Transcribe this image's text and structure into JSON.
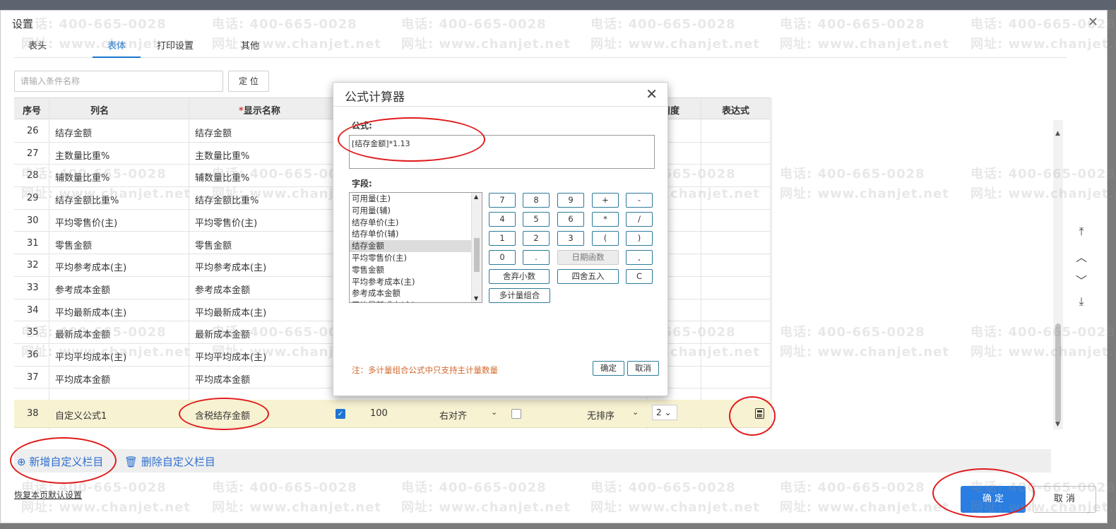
{
  "dialog": {
    "title": "设置",
    "close": "✕"
  },
  "tabs": [
    "表头",
    "表体",
    "打印设置",
    "其他"
  ],
  "search": {
    "placeholder": "请输入条件名称",
    "locate_label": "定 位"
  },
  "table": {
    "headers": {
      "no": "序号",
      "col_name": "列名",
      "required_mark": "*",
      "display_name": "显示名称",
      "precision": "精度",
      "expression": "表达式"
    },
    "rows": [
      {
        "no": "26",
        "name": "结存金额",
        "display": "结存金额"
      },
      {
        "no": "27",
        "name": "主数量比重%",
        "display": "主数量比重%"
      },
      {
        "no": "28",
        "name": "辅数量比重%",
        "display": "辅数量比重%"
      },
      {
        "no": "29",
        "name": "结存金额比重%",
        "display": "结存金额比重%"
      },
      {
        "no": "30",
        "name": "平均零售价(主)",
        "display": "平均零售价(主)"
      },
      {
        "no": "31",
        "name": "零售金额",
        "display": "零售金额"
      },
      {
        "no": "32",
        "name": "平均参考成本(主)",
        "display": "平均参考成本(主)"
      },
      {
        "no": "33",
        "name": "参考成本金额",
        "display": "参考成本金额"
      },
      {
        "no": "34",
        "name": "平均最新成本(主)",
        "display": "平均最新成本(主)"
      },
      {
        "no": "35",
        "name": "最新成本金额",
        "display": "最新成本金额"
      },
      {
        "no": "36",
        "name": "平均平均成本(主)",
        "display": "平均平均成本(主)"
      },
      {
        "no": "37",
        "name": "平均成本金额",
        "display": "平均成本金额"
      }
    ],
    "selected_row": {
      "no": "38",
      "name": "自定义公式1",
      "display": "含税结存金额",
      "width": "100",
      "align": "右对齐",
      "sort": "无排序",
      "precision": "2"
    }
  },
  "footer": {
    "add_custom": "新增自定义栏目",
    "delete_custom": "删除自定义栏目",
    "restore": "恢复本页默认设置",
    "ok": "确 定",
    "cancel": "取 消"
  },
  "formula_dialog": {
    "title": "公式计算器",
    "close": "✕",
    "formula_label": "公式:",
    "formula_value": "[结存金额]*1.13",
    "fields_label": "字段:",
    "fields": [
      "可用量(主)",
      "可用量(辅)",
      "结存单价(主)",
      "结存单价(辅)",
      "结存金额",
      "平均零售价(主)",
      "零售金额",
      "平均参考成本(主)",
      "参考成本金额",
      "平均最新成本(主)"
    ],
    "selected_field_index": 4,
    "keys": {
      "k7": "7",
      "k8": "8",
      "k9": "9",
      "plus": "+",
      "minus": "-",
      "k4": "4",
      "k5": "5",
      "k6": "6",
      "mul": "*",
      "div": "/",
      "k1": "1",
      "k2": "2",
      "k3": "3",
      "lparen": "(",
      "rparen": ")",
      "k0": "0",
      "dot": ".",
      "date_func": "日期函数",
      "comma": ",",
      "truncate": "舍弃小数",
      "round": "四舍五入",
      "clear": "C",
      "multi_unit": "多计量组合"
    },
    "note": "注：多计量组合公式中只支持主计量数量",
    "ok": "确定",
    "cancel": "取消"
  },
  "watermark": {
    "phone": "电话: 400-665-0028",
    "site": "网址: www.chanjet.net"
  },
  "colors": {
    "accent": "#2a7de1",
    "highlight_row": "#f7f2d2",
    "annotation_red": "#e01b1b",
    "note_orange": "#d1682b"
  }
}
